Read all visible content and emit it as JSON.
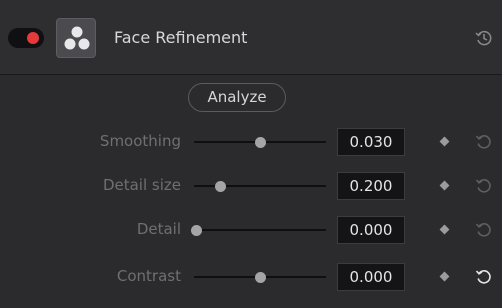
{
  "header": {
    "title": "Face Refinement",
    "enabled": true,
    "toggle_color": "#e63a3a",
    "effect_icon": "three-circles-icon",
    "history_icon": "history-icon"
  },
  "analyze_label": "Analyze",
  "params": [
    {
      "label": "Smoothing",
      "value": "0.030",
      "slider_fraction": 0.5,
      "reset_active": false
    },
    {
      "label": "Detail size",
      "value": "0.200",
      "slider_fraction": 0.2,
      "reset_active": false
    },
    {
      "label": "Detail",
      "value": "0.000",
      "slider_fraction": 0.0,
      "reset_active": false
    },
    {
      "label": "Contrast",
      "value": "0.000",
      "slider_fraction": 0.5,
      "reset_active": true
    }
  ]
}
